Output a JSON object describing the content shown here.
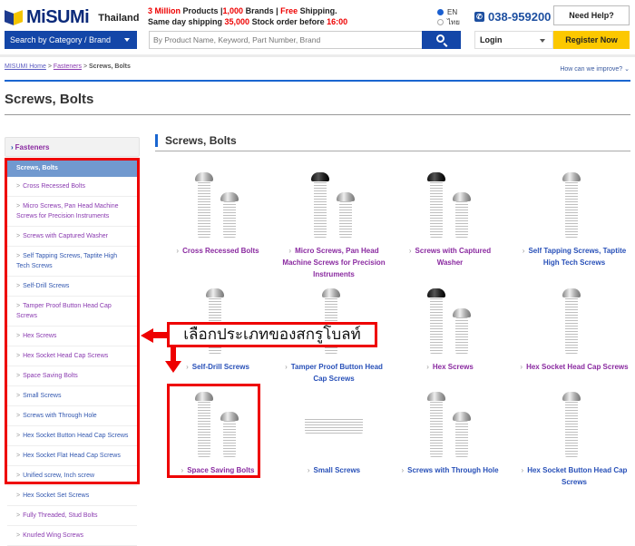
{
  "header": {
    "logo_text": "MiSUMi",
    "country": "Thailand",
    "promo_line1": {
      "a": "3 Million",
      "b": " Products |",
      "c": "1,000",
      "d": " Brands | ",
      "e": "Free",
      "f": " Shipping."
    },
    "promo_line2": {
      "a": "Same day shipping ",
      "b": "35,000",
      "c": " Stock order before ",
      "d": "16:00"
    },
    "lang_options": [
      {
        "label": "EN",
        "selected": true
      },
      {
        "label": "ไทย",
        "selected": false
      }
    ],
    "phone": "038-959200",
    "help_label": "Need Help?",
    "category_label": "Search by Category / Brand",
    "search_placeholder": "By Product Name, Keyword, Part Number, Brand",
    "login_label": "Login",
    "register_label": "Register Now"
  },
  "breadcrumb": {
    "items": [
      "MISUMI Home",
      "Fasteners"
    ],
    "current": "Screws, Bolts",
    "sep": " > "
  },
  "improve_label": "How can we improve? ⌄",
  "page_title": "Screws, Bolts",
  "sidebar": {
    "parent": "Fasteners",
    "current": "Screws, Bolts",
    "items": [
      "Cross Recessed Bolts",
      "Micro Screws, Pan Head Machine Screws for Precision Instruments",
      "Screws with Captured Washer",
      "Self Tapping Screws, Taptite High Tech Screws",
      "Self-Drill Screws",
      "Tamper Proof Button Head Cap Screws",
      "Hex Screws",
      "Hex Socket Head Cap Screws",
      "Space Saving Bolts",
      "Small Screws",
      "Screws with Through Hole",
      "Hex Socket Button Head Cap Screws",
      "Hex Socket Flat Head Cap Screws",
      "Unified screw, Inch screw",
      "Hex Socket Set Screws",
      "Fully Threaded, Stud Bolts",
      "Knurled Wing Screws"
    ]
  },
  "main": {
    "title": "Screws, Bolts",
    "products": [
      "Cross Recessed Bolts",
      "Micro Screws, Pan Head Machine Screws for Precision Instruments",
      "Screws with Captured Washer",
      "Self Tapping Screws, Taptite High Tech Screws",
      "Self-Drill Screws",
      "Tamper Proof Button Head Cap Screws",
      "Hex Screws",
      "Hex Socket Head Cap Screws",
      "Space Saving Bolts",
      "Small Screws",
      "Screws with Through Hole",
      "Hex Socket Button Head Cap Screws"
    ]
  },
  "annotation": {
    "callout_text": "เลือกประเภทของสกรูโบลท์",
    "color": "#ee0000"
  },
  "colors": {
    "brand_blue": "#1346a8",
    "register_yellow": "#fcc800",
    "visited_link": "#8a2aa0",
    "link": "#2850b8"
  }
}
